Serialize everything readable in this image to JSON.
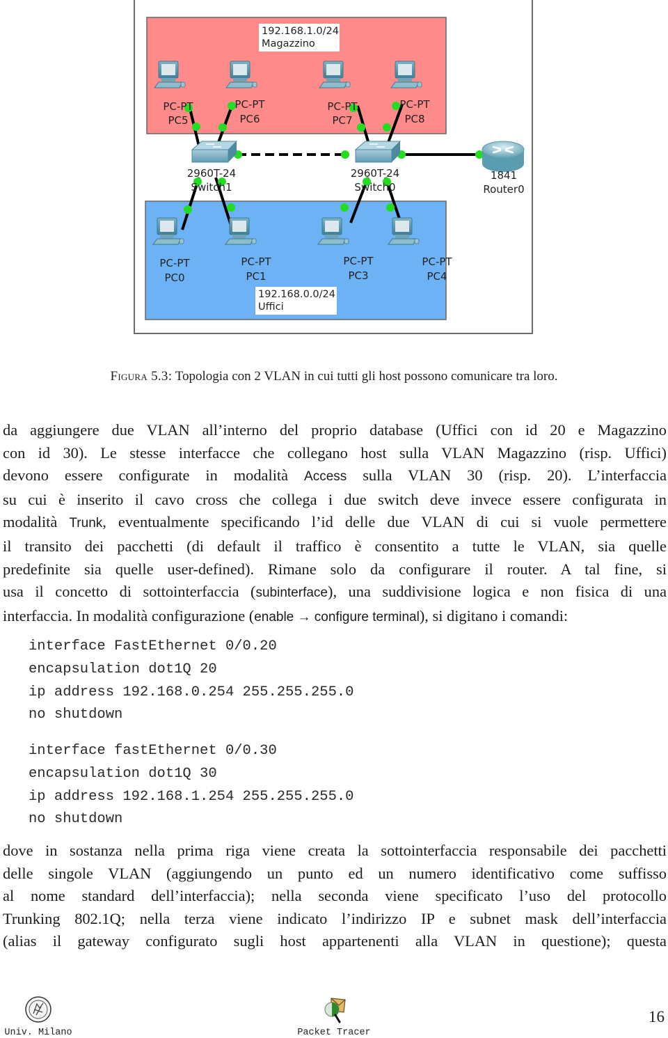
{
  "figure": {
    "vlans": [
      {
        "subnet": "192.168.1.0/24",
        "name": "Magazzino",
        "color": "#ff8a8a"
      },
      {
        "subnet": "192.168.0.0/24",
        "name": "Uffici",
        "color": "#6cb2f5"
      }
    ],
    "pcs_top": [
      {
        "type": "PC-PT",
        "name": "PC5"
      },
      {
        "type": "PC-PT",
        "name": "PC6"
      },
      {
        "type": "PC-PT",
        "name": "PC7"
      },
      {
        "type": "PC-PT",
        "name": "PC8"
      }
    ],
    "pcs_bottom": [
      {
        "type": "PC-PT",
        "name": "PC0"
      },
      {
        "type": "PC-PT",
        "name": "PC1"
      },
      {
        "type": "PC-PT",
        "name": "PC3"
      },
      {
        "type": "PC-PT",
        "name": "PC4"
      }
    ],
    "switches": [
      {
        "model": "2960-24",
        "model_display": "2960T-24",
        "name": "Switch1"
      },
      {
        "model": "2960-24",
        "model_display": "2960T-24",
        "name": "Switch0"
      }
    ],
    "router": {
      "model": "1841",
      "name": "Router0"
    },
    "link_color": "#000000",
    "port_color": "#22dd22",
    "caption_label": "Figura 5.3:",
    "caption_text": "Topologia con 2 VLAN in cui tutti gli host possono comunicare tra loro."
  },
  "paragraph1": {
    "lines": [
      [
        {
          "t": "da aggiungere due VLAN all’interno del proprio database (Uffici con id 20 e Magazzino"
        }
      ],
      [
        {
          "t": "con id 30). Le stesse interfacce che collegano host sulla VLAN Magazzino (risp. Uffici)"
        }
      ],
      [
        {
          "t": "devono essere configurate in modalità "
        },
        {
          "t": "Access",
          "sans": true
        },
        {
          "t": " sulla VLAN 30 (risp.  20).  L’interfaccia"
        }
      ],
      [
        {
          "t": "su cui è inserito il cavo cross che collega i due switch deve invece essere configurata in"
        }
      ],
      [
        {
          "t": "modalità "
        },
        {
          "t": "Trunk",
          "sans": true
        },
        {
          "t": ", eventualmente specificando l’id delle due VLAN di cui si vuole permettere"
        }
      ],
      [
        {
          "t": "il transito dei pacchetti (di default il traffico è consentito a tutte le VLAN, sia quelle"
        }
      ],
      [
        {
          "t": "predefinite sia quelle user-defined). Rimane solo da configurare il router.  A tal fine, si"
        }
      ],
      [
        {
          "t": "usa il concetto di sottointerfaccia ("
        },
        {
          "t": "subinterface",
          "sans": true
        },
        {
          "t": "), una suddivisione logica e non fisica di una"
        }
      ],
      [
        {
          "t": "interfaccia. In modalità configurazione ("
        },
        {
          "t": "enable → configure terminal",
          "sans": true
        },
        {
          "t": "), si digitano i comandi:"
        }
      ]
    ]
  },
  "code_block_1": [
    "interface FastEthernet 0/0.20",
    "encapsulation dot1Q 20",
    "ip address 192.168.0.254 255.255.255.0",
    "no shutdown"
  ],
  "code_block_2": [
    "interface fastEthernet 0/0.30",
    "encapsulation dot1Q 30",
    "ip address 192.168.1.254 255.255.255.0",
    "no shutdown"
  ],
  "paragraph2": {
    "lines": [
      [
        {
          "t": "dove in sostanza nella prima riga viene creata la sottointerfaccia responsabile dei pacchetti"
        }
      ],
      [
        {
          "t": "delle singole VLAN (aggiungendo un punto ed un numero identificativo come suffisso"
        }
      ],
      [
        {
          "t": "al nome standard dell’interfaccia); nella seconda viene specificato l’uso del protocollo"
        }
      ],
      [
        {
          "t": "Trunking 802.1Q; nella terza viene indicato l’indirizzo IP e subnet mask dell’interfaccia"
        }
      ],
      [
        {
          "t": "(alias il gateway configurato sugli host appartenenti alla VLAN in questione); questa"
        }
      ]
    ]
  },
  "footer": {
    "left_label": "Univ. Milano",
    "left_icon": "university-seal-icon",
    "center_label": "Packet Tracer",
    "center_icon": "packet-tracer-icon",
    "page_number": "16"
  }
}
